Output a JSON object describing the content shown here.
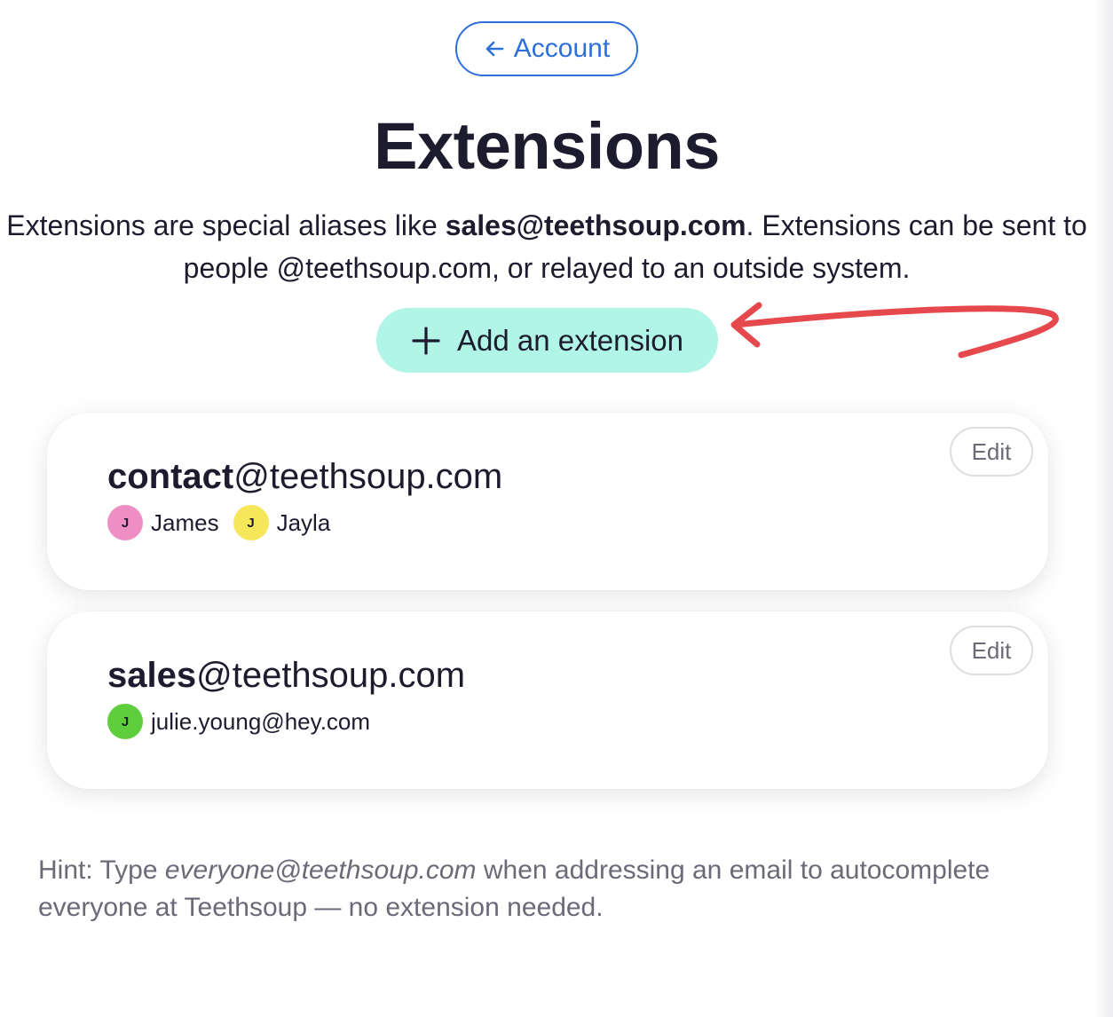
{
  "nav": {
    "back_label": "Account",
    "back_icon": "arrow-left-icon"
  },
  "page": {
    "title": "Extensions"
  },
  "intro": {
    "part1": "Extensions are special aliases like ",
    "example": "sales@teethsoup.com",
    "part2": ". Extensions can be sent to people @teethsoup.com, or relayed to an outside system."
  },
  "add_button": {
    "label": "Add an extension",
    "icon": "plus-icon"
  },
  "extensions": [
    {
      "local": "contact",
      "domain": "@teethsoup.com",
      "edit_label": "Edit",
      "recipients": [
        {
          "initial": "J",
          "name": "James",
          "color": "#ee8ec3"
        },
        {
          "initial": "J",
          "name": "Jayla",
          "color": "#f5e65a"
        }
      ]
    },
    {
      "local": "sales",
      "domain": "@teethsoup.com",
      "edit_label": "Edit",
      "recipients": [
        {
          "initial": "J",
          "name": "julie.young@hey.com",
          "color": "#5fce3c"
        }
      ]
    }
  ],
  "hint": {
    "prefix": "Hint: Type ",
    "example": "everyone@teethsoup.com",
    "suffix": " when addressing an email to autocomplete everyone at Teethsoup — no extension needed."
  },
  "colors": {
    "accent_blue": "#2f6fd8",
    "add_button_bg": "#b1f5e6",
    "annotation_red": "#e5484d",
    "text_dark": "#1d1c2e",
    "text_muted": "#6b6a78"
  }
}
